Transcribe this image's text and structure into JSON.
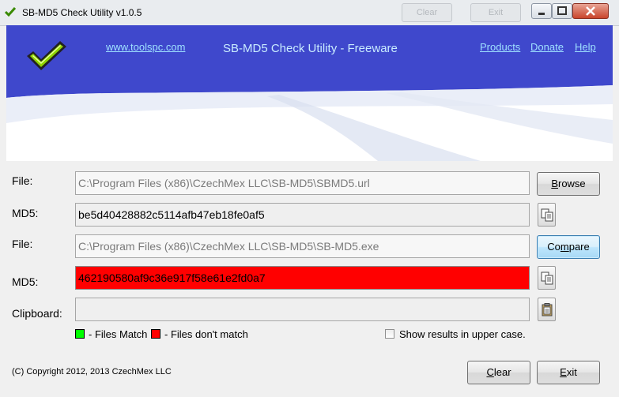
{
  "window": {
    "title": "SB-MD5 Check Utility  v1.0.5",
    "background_buttons": [
      "Clear",
      "Exit"
    ],
    "controls": [
      "minimize",
      "maximize",
      "close"
    ]
  },
  "header": {
    "site_link": "www.toolspc.com",
    "title": "SB-MD5 Check Utility - Freeware",
    "nav": [
      "Products",
      "Donate",
      "Help"
    ],
    "accent_color": "#3f48cc"
  },
  "rows": {
    "file1": {
      "label": "File:",
      "value": "C:\\Program Files (x86)\\CzechMex LLC\\SB-MD5\\SBMD5.url",
      "button_first": "B",
      "button_rest": "rowse"
    },
    "md5_1": {
      "label": "MD5:",
      "value": "be5d40428882c5114afb47eb18fe0af5",
      "copy_icon": "copy-icon"
    },
    "file2": {
      "label": "File:",
      "value": "C:\\Program Files (x86)\\CzechMex LLC\\SB-MD5\\SB-MD5.exe",
      "button_first": "Co",
      "button_underlined": "m",
      "button_rest": "pare"
    },
    "md5_2": {
      "label": "MD5:",
      "value": "462190580af9c36e917f58e61e2fd0a7",
      "status_color": "#ff0000",
      "copy_icon": "copy-icon"
    },
    "clipboard": {
      "label": "Clipboard:",
      "value": "",
      "paste_icon": "paste-icon"
    }
  },
  "legend": {
    "match_label": "- Files Match",
    "match_color": "#00ff00",
    "mismatch_label": "- Files don't match",
    "mismatch_color": "#ff0000",
    "uppercase_label": "Show results in upper case.",
    "uppercase_checked": false
  },
  "footer": {
    "copyright": "(C) Copyright 2012, 2013 CzechMex LLC",
    "clear_first": "C",
    "clear_rest": "lear",
    "exit_first": "E",
    "exit_rest": "xit"
  }
}
